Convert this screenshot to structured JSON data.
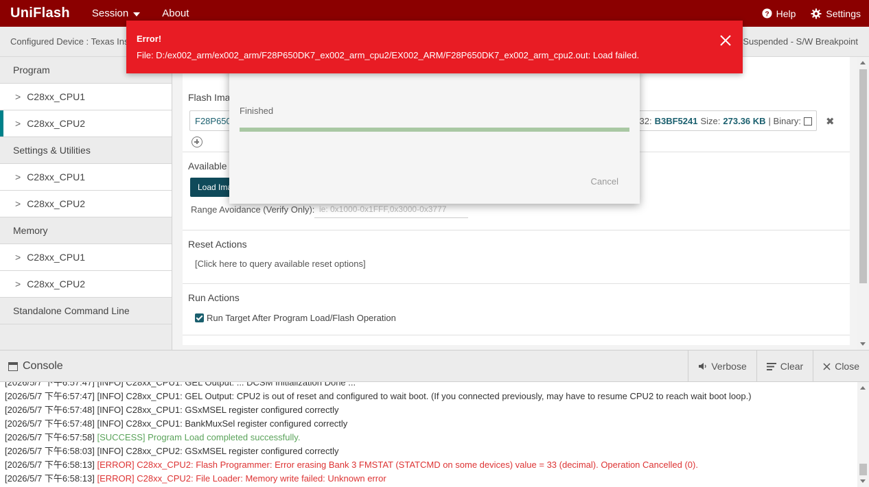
{
  "app": {
    "brand": "UniFlash",
    "menu": {
      "session": "Session",
      "about": "About"
    },
    "help": "Help",
    "settings": "Settings"
  },
  "statusbar": {
    "device": "Configured Device : Texas Ins",
    "status": "Suspended - S/W Breakpoint"
  },
  "sidebar": {
    "program": "Program",
    "program_items": [
      "C28xx_CPU1",
      "C28xx_CPU2"
    ],
    "settings": "Settings & Utilities",
    "settings_items": [
      "C28xx_CPU1",
      "C28xx_CPU2"
    ],
    "memory": "Memory",
    "memory_items": [
      "C28xx_CPU1",
      "C28xx_CPU2"
    ],
    "standalone": "Standalone Command Line",
    "chevron": ">"
  },
  "main": {
    "flash_title": "Flash Ima",
    "file_name": "F28P650",
    "crc_label": "C32:",
    "crc_value": "B3BF5241",
    "size_label": "Size:",
    "size_value": "273.36 KB",
    "binary_label": "| Binary:",
    "available_title": "Available",
    "load_button": "Load Ima",
    "range_label": "Range Avoidance (Verify Only):",
    "range_placeholder": "ie: 0x1000-0x1FFF,0x3000-0x3777",
    "reset_title": "Reset Actions",
    "reset_link": "[Click here to query available reset options]",
    "run_title": "Run Actions",
    "run_checkbox": "Run Target After Program Load/Flash Operation"
  },
  "dialog": {
    "status": "Finished",
    "progress": 1.0,
    "cancel": "Cancel"
  },
  "error": {
    "title": "Error!",
    "message": "File: D:/ex002_arm/ex002_arm/F28P650DK7_ex002_arm_cpu2/EX002_ARM/F28P650DK7_ex002_arm_cpu2.out: Load failed."
  },
  "console": {
    "title": "Console",
    "verbose": "Verbose",
    "clear": "Clear",
    "close": "Close",
    "logs": [
      {
        "ts": "[2026/5/7 下午6:57:47]",
        "msg": "[INFO] C28xx_CPU1: GEL Output: ... DCSM Initialization Done ...",
        "type": "info"
      },
      {
        "ts": "[2026/5/7 下午6:57:47]",
        "msg": "[INFO] C28xx_CPU1: GEL Output: CPU2 is out of reset and configured to wait boot. (If you connected previously, may have to resume CPU2 to reach wait boot loop.)",
        "type": "info"
      },
      {
        "ts": "[2026/5/7 下午6:57:48]",
        "msg": "[INFO] C28xx_CPU1: GSxMSEL register configured correctly",
        "type": "info"
      },
      {
        "ts": "[2026/5/7 下午6:57:48]",
        "msg": "[INFO] C28xx_CPU1: BankMuxSel register configured correctly",
        "type": "info"
      },
      {
        "ts": "[2026/5/7 下午6:57:58]",
        "msg": "[SUCCESS] Program Load completed successfully.",
        "type": "success"
      },
      {
        "ts": "[2026/5/7 下午6:58:03]",
        "msg": "[INFO] C28xx_CPU2: GSxMSEL register configured correctly",
        "type": "info"
      },
      {
        "ts": "[2026/5/7 下午6:58:13]",
        "msg": "[ERROR] C28xx_CPU2: Flash Programmer: Error erasing Bank 3 FMSTAT (STATCMD on some devices) value = 33 (decimal). Operation Cancelled (0).",
        "type": "error"
      },
      {
        "ts": "[2026/5/7 下午6:58:13]",
        "msg": "[ERROR] C28xx_CPU2: File Loader: Memory write failed: Unknown error",
        "type": "error"
      }
    ]
  },
  "colors": {
    "topbar": "#8b0000",
    "accent": "#00818a",
    "error": "#e81c24",
    "success_text": "#5aa35a",
    "error_text": "#d33333"
  }
}
